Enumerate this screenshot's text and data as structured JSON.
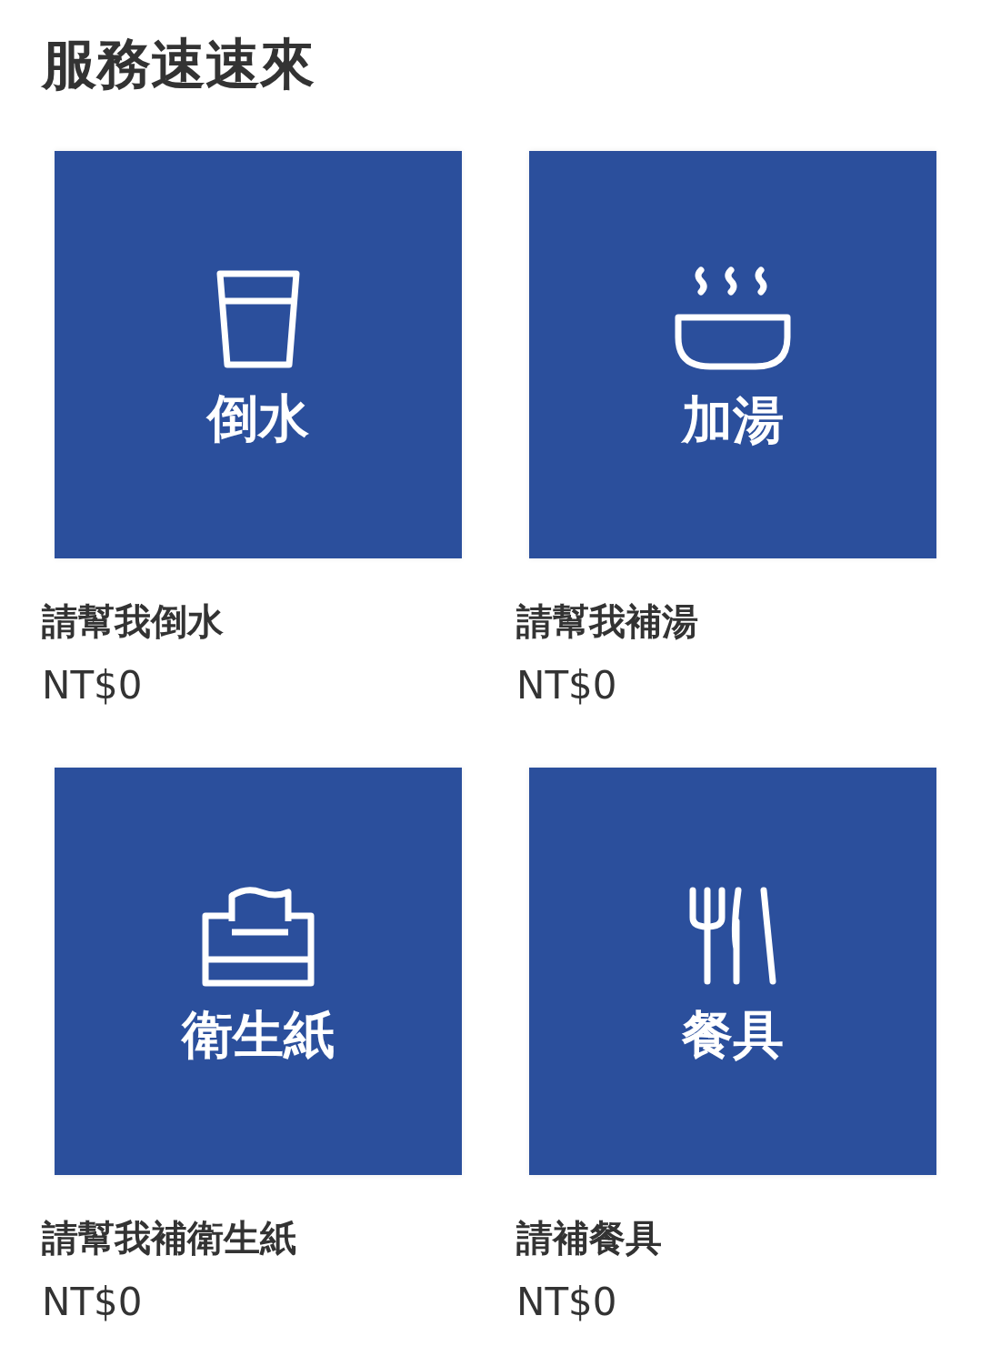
{
  "title": "服務速速來",
  "items": [
    {
      "kind": "glass",
      "tile_label": "倒水",
      "name": "請幫我倒水",
      "price": "NT$0"
    },
    {
      "kind": "bowl",
      "tile_label": "加湯",
      "name": "請幫我補湯",
      "price": "NT$0"
    },
    {
      "kind": "tissue",
      "tile_label": "衛生紙",
      "name": "請幫我補衛生紙",
      "price": "NT$0"
    },
    {
      "kind": "utensils",
      "tile_label": "餐具",
      "name": "請補餐具",
      "price": "NT$0"
    }
  ]
}
